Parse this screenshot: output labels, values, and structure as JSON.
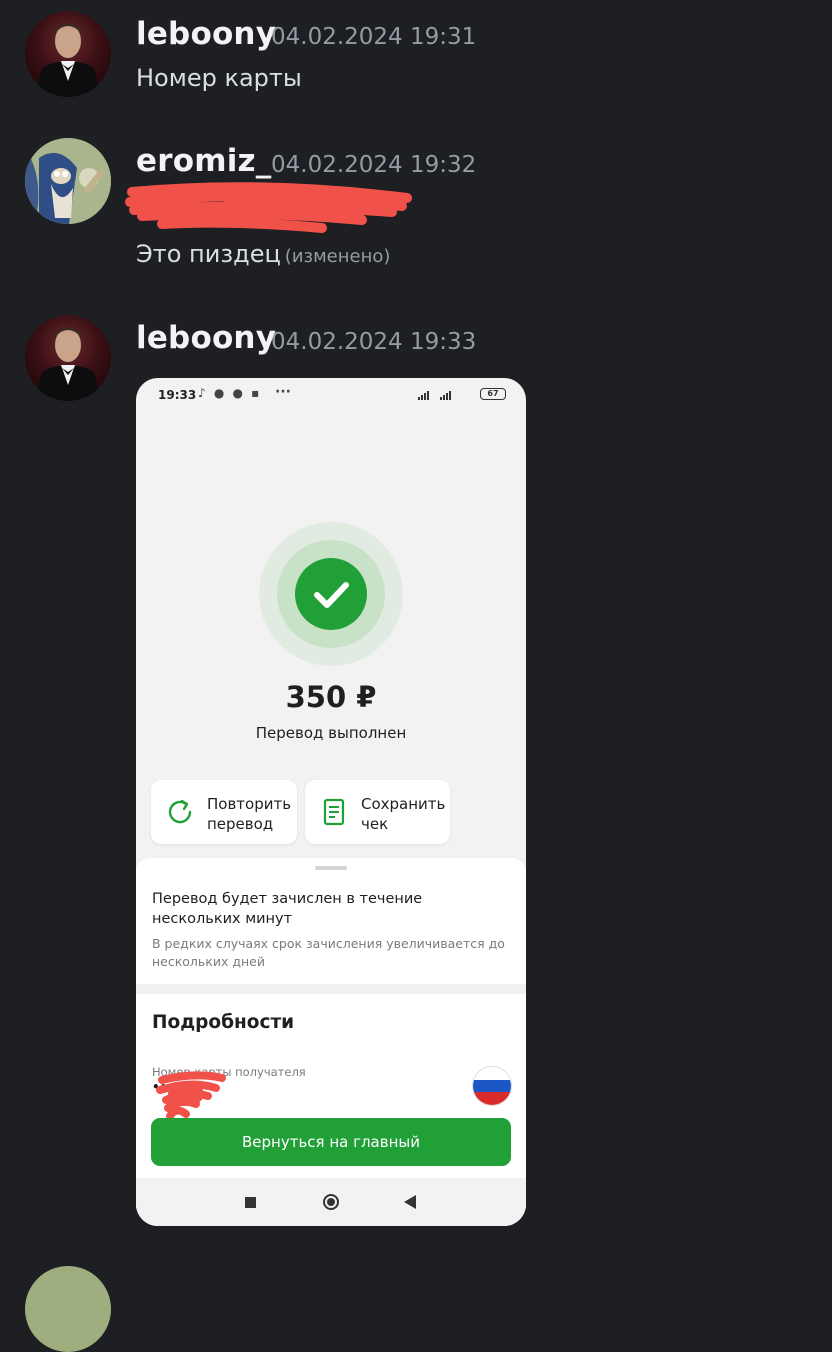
{
  "messages": [
    {
      "username": "leboony",
      "timestamp": "04.02.2024 19:31",
      "text": "Номер карты"
    },
    {
      "username": "eromiz_",
      "timestamp": "04.02.2024 19:32",
      "text": "Это пиздец",
      "edited_label": "(изменено)"
    },
    {
      "username": "leboony",
      "timestamp": "04.02.2024 19:33"
    }
  ],
  "phone": {
    "status_time": "19:33",
    "status_more": "···",
    "battery": "67",
    "amount": "350 ₽",
    "status_text": "Перевод выполнен",
    "repeat_button": "Повторить\nперевод",
    "save_button": "Сохранить\nчек",
    "info_title": "Перевод будет зачислен в течение нескольких минут",
    "info_subtitle": "В редких случаях срок зачисления увеличивается до нескольких дней",
    "details_heading": "Подробности",
    "card_label": "Номер карты получателя",
    "card_value": "••",
    "return_button": "Вернуться на главный"
  },
  "colors": {
    "background": "#1e1f22",
    "accent_green": "#21a038",
    "redaction": "#f0524a"
  }
}
